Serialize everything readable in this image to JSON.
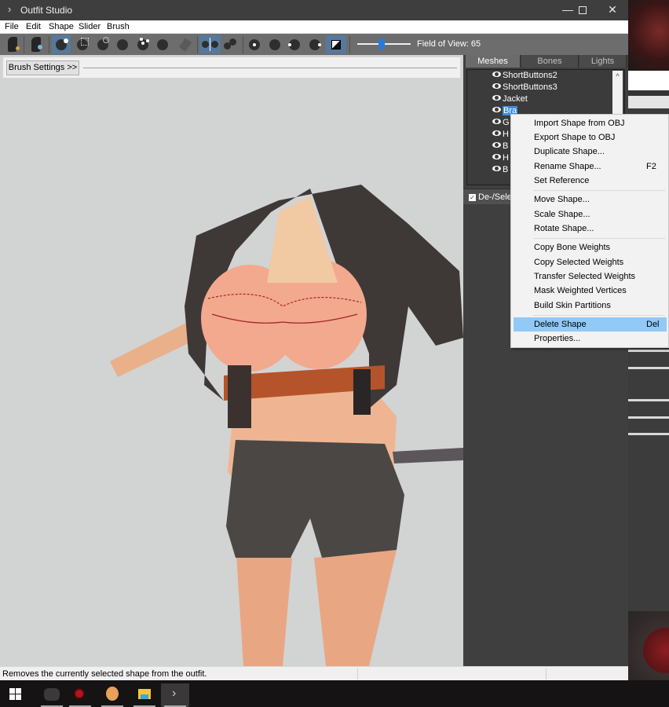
{
  "window": {
    "title": "Outfit Studio",
    "controls": {
      "minimize": "—",
      "maximize": "",
      "close": "✕"
    }
  },
  "menubar": {
    "items": [
      "File",
      "Edit",
      "Shape",
      "Slider",
      "Brush"
    ]
  },
  "toolbar": {
    "buttons": [
      {
        "name": "load-reference-icon",
        "active": false
      },
      {
        "name": "load-outfit-icon",
        "active": false
      },
      {
        "name": "select-brush-icon",
        "active": true
      },
      {
        "name": "mask-brush-icon",
        "active": false
      },
      {
        "name": "inflate-brush-icon",
        "active": false
      },
      {
        "name": "deflate-brush-icon",
        "active": false
      },
      {
        "name": "move-brush-icon",
        "active": false
      },
      {
        "name": "smooth-brush-icon",
        "active": false
      },
      {
        "name": "weight-paint-brush-icon",
        "active": false
      },
      {
        "name": "x-mirror-icon",
        "active": true
      },
      {
        "name": "connected-only-icon",
        "active": false
      },
      {
        "name": "front-view-icon",
        "active": false
      },
      {
        "name": "back-view-icon",
        "active": false
      },
      {
        "name": "left-view-icon",
        "active": false
      },
      {
        "name": "right-view-icon",
        "active": false
      },
      {
        "name": "perspective-toggle-icon",
        "active": true
      }
    ],
    "field_of_view_label": "Field of View: 65",
    "field_of_view_value": 65
  },
  "viewport": {
    "brush_settings_button": "Brush Settings >>"
  },
  "right_panel": {
    "tabs": [
      {
        "label": "Meshes",
        "active": true
      },
      {
        "label": "Bones",
        "active": false
      },
      {
        "label": "Lights",
        "active": false
      }
    ],
    "meshes": [
      {
        "label": "ShortButtons2",
        "selected": false
      },
      {
        "label": "ShortButtons3",
        "selected": false
      },
      {
        "label": "Jacket",
        "selected": false
      },
      {
        "label": "Bra",
        "selected": true
      },
      {
        "label": "G",
        "selected": false
      },
      {
        "label": "H",
        "selected": false
      },
      {
        "label": "B",
        "selected": false
      },
      {
        "label": "H",
        "selected": false
      },
      {
        "label": "B",
        "selected": false
      }
    ],
    "scroll_up": "^",
    "deselect_checkbox_label": "De-/Select",
    "deselect_checked": true
  },
  "context_menu": {
    "groups": [
      [
        {
          "label": "Import Shape from OBJ",
          "shortcut": ""
        },
        {
          "label": "Export Shape to OBJ",
          "shortcut": ""
        },
        {
          "label": "Duplicate Shape...",
          "shortcut": ""
        },
        {
          "label": "Rename Shape...",
          "shortcut": "F2"
        },
        {
          "label": "Set Reference",
          "shortcut": ""
        }
      ],
      [
        {
          "label": "Move Shape...",
          "shortcut": ""
        },
        {
          "label": "Scale Shape...",
          "shortcut": ""
        },
        {
          "label": "Rotate Shape...",
          "shortcut": ""
        }
      ],
      [
        {
          "label": "Copy Bone Weights",
          "shortcut": ""
        },
        {
          "label": "Copy Selected Weights",
          "shortcut": ""
        },
        {
          "label": "Transfer Selected Weights",
          "shortcut": ""
        },
        {
          "label": "Mask Weighted Vertices",
          "shortcut": ""
        },
        {
          "label": "Build Skin Partitions",
          "shortcut": ""
        }
      ],
      [
        {
          "label": "Delete Shape",
          "shortcut": "Del",
          "highlighted": true
        },
        {
          "label": "Properties...",
          "shortcut": ""
        }
      ]
    ]
  },
  "statusbar": {
    "text": "Removes the currently selected shape from the outfit."
  },
  "taskbar": {
    "items": [
      "start-button",
      "blurred-app",
      "red-circle-app",
      "character-app",
      "file-explorer",
      "outfit-studio"
    ]
  },
  "colors": {
    "accent_selection": "#3c8be0",
    "menu_highlight": "#91c9f7",
    "toolbar_active": "#55799e",
    "viewport_bg": "#d2d3d3"
  }
}
